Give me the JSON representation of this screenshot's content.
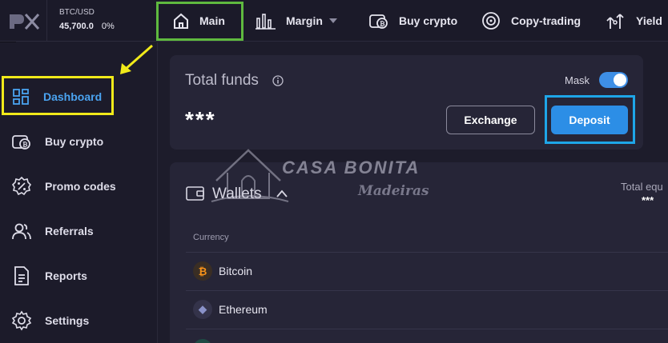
{
  "ticker": {
    "pair": "BTC/USD",
    "price": "45,700.0",
    "change": "0%"
  },
  "topnav": {
    "main": "Main",
    "margin": "Margin",
    "buy_crypto": "Buy crypto",
    "copy_trading": "Copy-trading",
    "yield": "Yield"
  },
  "sidebar": {
    "items": [
      {
        "label": "Dashboard",
        "icon": "grid-icon"
      },
      {
        "label": "Buy crypto",
        "icon": "wallet-coin-icon"
      },
      {
        "label": "Promo codes",
        "icon": "percent-badge-icon"
      },
      {
        "label": "Referrals",
        "icon": "users-icon"
      },
      {
        "label": "Reports",
        "icon": "document-icon"
      },
      {
        "label": "Settings",
        "icon": "gear-icon"
      }
    ]
  },
  "funds": {
    "title": "Total funds",
    "value": "***",
    "mask_label": "Mask",
    "exchange_label": "Exchange",
    "deposit_label": "Deposit"
  },
  "wallets": {
    "title": "Wallets",
    "total_equity_label": "Total equ",
    "total_equity_value": "***",
    "currency_header": "Currency",
    "rows": [
      {
        "name": "Bitcoin",
        "symbol": "₿"
      },
      {
        "name": "Ethereum",
        "symbol": "◆"
      }
    ]
  },
  "watermark": {
    "title": "CASA BONITA",
    "subtitle": "Madeiras"
  },
  "colors": {
    "accent_blue": "#2c8ee6",
    "highlight_green": "#5fb93f",
    "highlight_yellow": "#f1ea1a",
    "highlight_cyan": "#1ea6e8"
  }
}
